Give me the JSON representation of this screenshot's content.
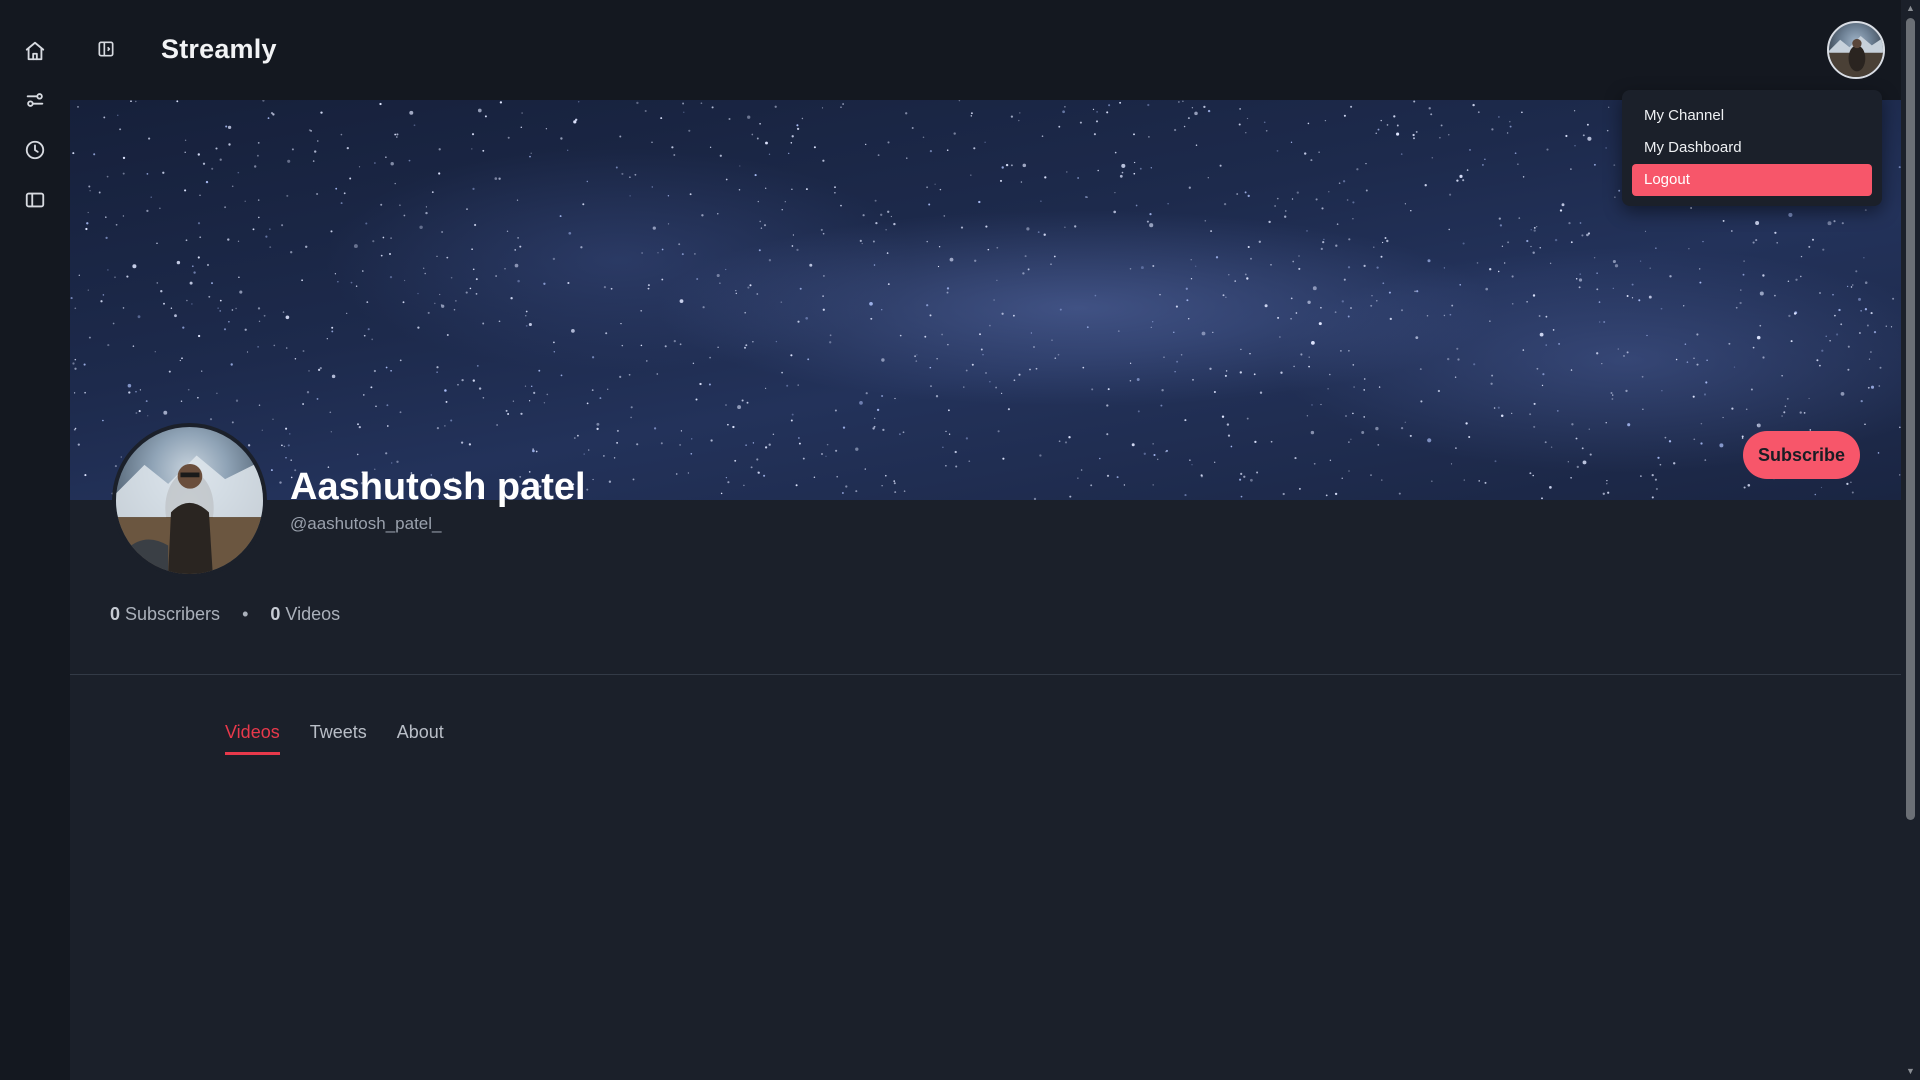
{
  "app": {
    "brand": "Streamly"
  },
  "rail": {
    "items": [
      {
        "icon": "home-icon"
      },
      {
        "icon": "sliders-icon"
      },
      {
        "icon": "clock-icon"
      },
      {
        "icon": "panel-icon"
      }
    ]
  },
  "header": {
    "collapse_icon": "sidebar-toggle-icon"
  },
  "user_menu": {
    "items": [
      {
        "label": "My Channel"
      },
      {
        "label": "My Dashboard"
      },
      {
        "label": "Logout"
      }
    ],
    "active_index": 2
  },
  "channel": {
    "name": "Aashutosh patel",
    "handle": "@aashutosh_patel_",
    "subscribe_label": "Subscribe",
    "subscribers_count": "0",
    "subscribers_label": "Subscribers",
    "separator": "•",
    "videos_count": "0",
    "videos_label": "Videos"
  },
  "tabs": [
    {
      "label": "Videos"
    },
    {
      "label": "Tweets"
    },
    {
      "label": "About"
    }
  ],
  "active_tab": 0,
  "colors": {
    "accent": "#f7566a",
    "tab_active": "#e8394b",
    "background": "#1b202a",
    "header_bg": "#141820"
  }
}
